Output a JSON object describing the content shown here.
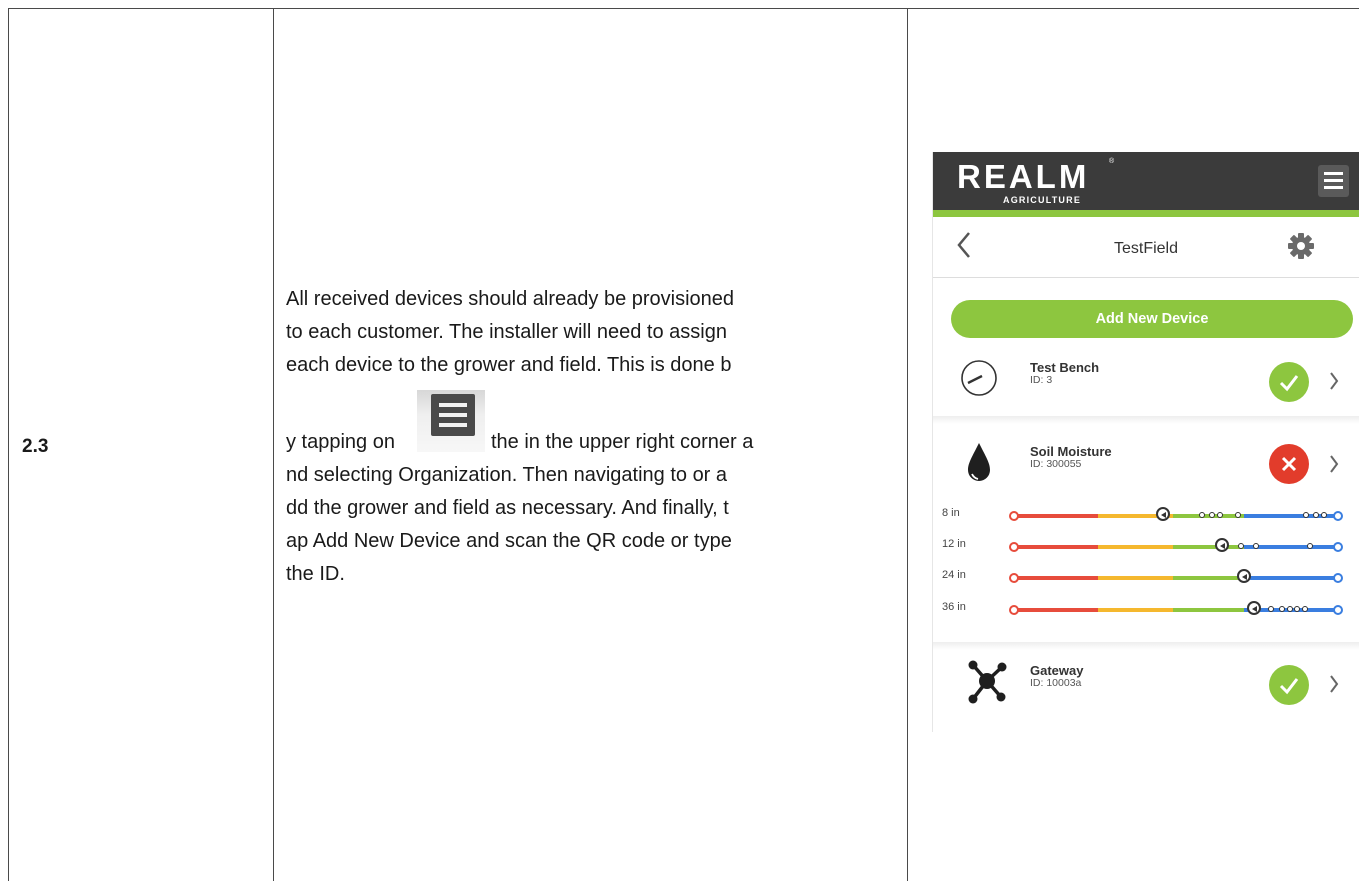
{
  "step": {
    "number": "2.3",
    "text_lines": [
      "All received devices should already be provisioned",
      "to each customer. The installer will need to assign",
      "each device to the grower and field. This is done b",
      "the in the upper right corner a",
      "nd selecting Organization. Then navigating to or a",
      "dd the grower and field as necessary. And finally, t",
      "ap Add New Device and scan the QR code or type",
      "the ID."
    ],
    "text_before_icon": "y tapping on",
    "inline_icon": "hamburger-menu-icon"
  },
  "app": {
    "logo": {
      "main": "REALM",
      "sub": "AGRICULTURE",
      "reg": "®"
    },
    "page_title": "TestField",
    "add_button_label": "Add New Device",
    "devices": [
      {
        "name": "Test Bench",
        "id_text": "ID: 3",
        "icon": "gauge-dial-icon",
        "status": "ok"
      },
      {
        "name": "Soil Moisture",
        "id_text": "ID: 300055",
        "icon": "water-drop-icon",
        "status": "error"
      },
      {
        "name": "Gateway",
        "id_text": "ID: 10003a",
        "icon": "network-hub-icon",
        "status": "ok"
      }
    ],
    "moisture_depths": [
      {
        "label": "8 in",
        "level": 0.46,
        "history": [
          0.58,
          0.61,
          0.635,
          0.69,
          0.9,
          0.93,
          0.955
        ]
      },
      {
        "label": "12 in",
        "level": 0.64,
        "history": [
          0.7,
          0.745,
          0.91
        ]
      },
      {
        "label": "24 in",
        "level": 0.71,
        "history": []
      },
      {
        "label": "36 in",
        "level": 0.74,
        "history": [
          0.79,
          0.825,
          0.85,
          0.87,
          0.895
        ]
      }
    ],
    "colors": {
      "header": "#3b3b3b",
      "accent_green": "#8dc63f",
      "gauge_red": "#e74c3c",
      "gauge_yellow": "#f5b82e",
      "gauge_green": "#8dc63f",
      "gauge_blue": "#3a7ee0",
      "error_red": "#e23c2b"
    }
  }
}
